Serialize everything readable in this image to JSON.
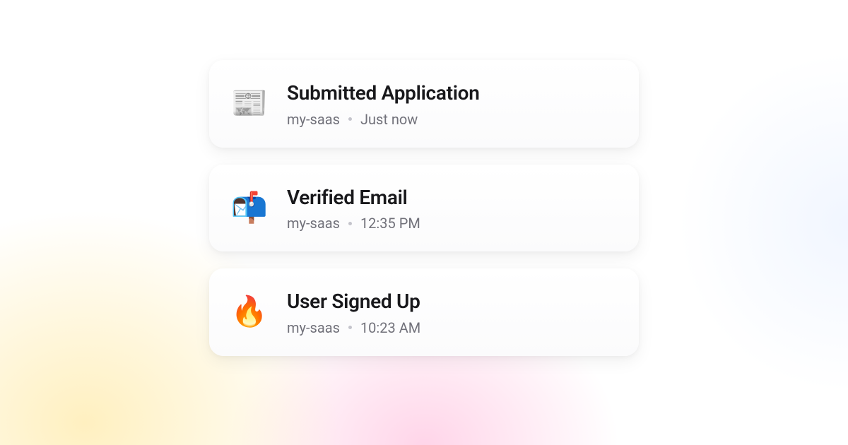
{
  "events": [
    {
      "icon": "📰",
      "icon_name": "newspaper-icon",
      "title": "Submitted Application",
      "project": "my-saas",
      "time": "Just now"
    },
    {
      "icon": "📬",
      "icon_name": "mailbox-icon",
      "title": "Verified Email",
      "project": "my-saas",
      "time": "12:35 PM"
    },
    {
      "icon": "🔥",
      "icon_name": "fire-icon",
      "title": "User Signed Up",
      "project": "my-saas",
      "time": "10:23 AM"
    }
  ]
}
